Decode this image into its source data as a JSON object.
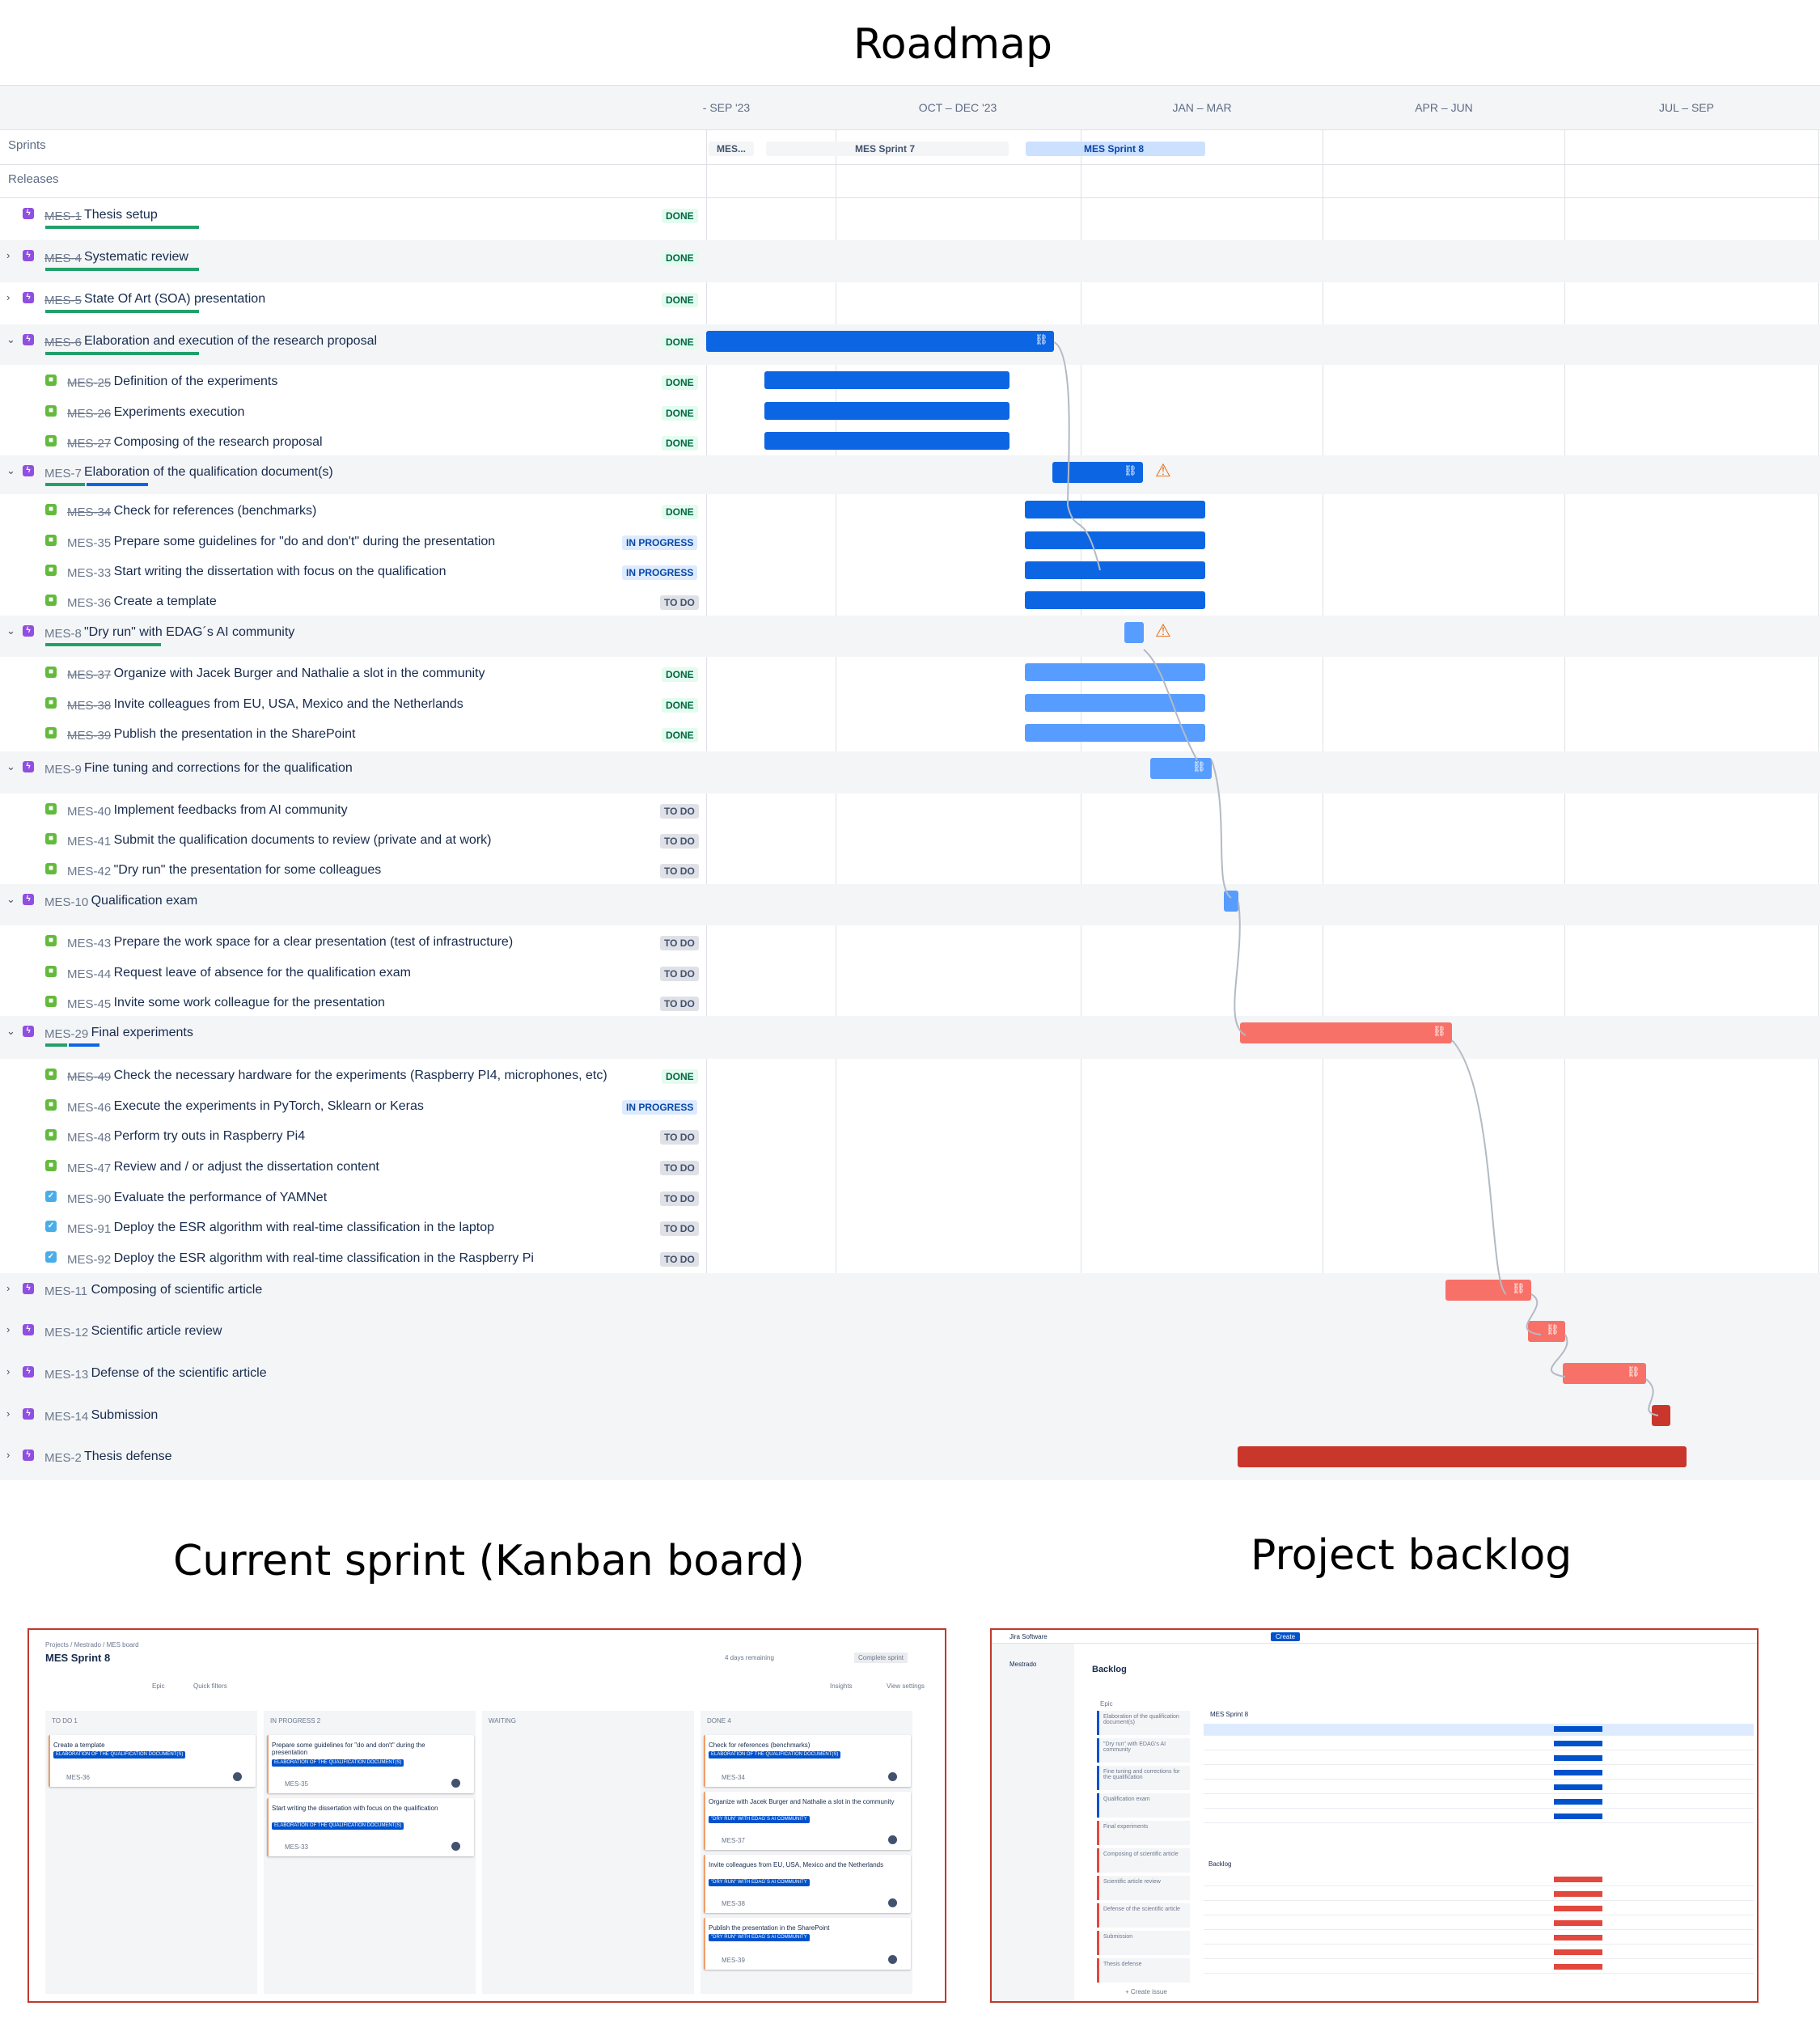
{
  "titles": {
    "roadmap": "Roadmap",
    "kanban": "Current sprint (Kanban board)",
    "backlog": "Project backlog"
  },
  "roadmap": {
    "periods": [
      "- SEP '23",
      "OCT – DEC '23",
      "JAN – MAR",
      "APR – JUN",
      "JUL – SEP"
    ],
    "sprints_label": "Sprints",
    "releases_label": "Releases",
    "sprints": [
      "MES...",
      "MES Sprint 7",
      "MES Sprint 8"
    ],
    "colors": {
      "blue": "#0c66e4",
      "light_blue": "#579dff",
      "salmon": "#f87168",
      "red": "#c9372c"
    },
    "rows": [
      {
        "key": "MES-1",
        "summary": "Thesis setup",
        "status": "DONE",
        "type": "epic",
        "done": true
      },
      {
        "key": "MES-4",
        "summary": "Systematic review",
        "status": "DONE",
        "type": "epic",
        "done": true
      },
      {
        "key": "MES-5",
        "summary": "State Of Art (SOA) presentation",
        "status": "DONE",
        "type": "epic",
        "done": true
      },
      {
        "key": "MES-6",
        "summary": "Elaboration and execution of the research proposal",
        "status": "DONE",
        "type": "epic",
        "done": true
      },
      {
        "key": "MES-25",
        "summary": "Definition of the experiments",
        "status": "DONE",
        "type": "story",
        "done": true
      },
      {
        "key": "MES-26",
        "summary": "Experiments execution",
        "status": "DONE",
        "type": "story",
        "done": true
      },
      {
        "key": "MES-27",
        "summary": "Composing of the research proposal",
        "status": "DONE",
        "type": "story",
        "done": true
      },
      {
        "key": "MES-7",
        "summary": "Elaboration of the qualification document(s)",
        "status": "",
        "type": "epic",
        "done": false
      },
      {
        "key": "MES-34",
        "summary": "Check for references (benchmarks)",
        "status": "DONE",
        "type": "story",
        "done": true
      },
      {
        "key": "MES-35",
        "summary": "Prepare some guidelines for \"do and don't\" during the presentation",
        "status": "IN PROGRESS",
        "type": "story",
        "done": false
      },
      {
        "key": "MES-33",
        "summary": "Start writing the dissertation with focus on the qualification",
        "status": "IN PROGRESS",
        "type": "story",
        "done": false
      },
      {
        "key": "MES-36",
        "summary": "Create a template",
        "status": "TO DO",
        "type": "story",
        "done": false
      },
      {
        "key": "MES-8",
        "summary": "\"Dry run\" with EDAG´s AI community",
        "status": "",
        "type": "epic",
        "done": false
      },
      {
        "key": "MES-37",
        "summary": "Organize with Jacek Burger and Nathalie a slot in the community",
        "status": "DONE",
        "type": "story",
        "done": true
      },
      {
        "key": "MES-38",
        "summary": "Invite colleagues from EU, USA, Mexico and the Netherlands",
        "status": "DONE",
        "type": "story",
        "done": true
      },
      {
        "key": "MES-39",
        "summary": "Publish the presentation in the SharePoint",
        "status": "DONE",
        "type": "story",
        "done": true
      },
      {
        "key": "MES-9",
        "summary": "Fine tuning and corrections for the qualification",
        "status": "",
        "type": "epic",
        "done": false
      },
      {
        "key": "MES-40",
        "summary": "Implement feedbacks from AI community",
        "status": "TO DO",
        "type": "story",
        "done": false
      },
      {
        "key": "MES-41",
        "summary": "Submit the qualification documents to review (private and at work)",
        "status": "TO DO",
        "type": "story",
        "done": false
      },
      {
        "key": "MES-42",
        "summary": "\"Dry run\" the presentation for some colleagues",
        "status": "TO DO",
        "type": "story",
        "done": false
      },
      {
        "key": "MES-10",
        "summary": "Qualification exam",
        "status": "",
        "type": "epic",
        "done": false
      },
      {
        "key": "MES-43",
        "summary": "Prepare the work space for a clear presentation (test of infrastructure)",
        "status": "TO DO",
        "type": "story",
        "done": false
      },
      {
        "key": "MES-44",
        "summary": "Request leave of absence for the qualification exam",
        "status": "TO DO",
        "type": "story",
        "done": false
      },
      {
        "key": "MES-45",
        "summary": "Invite some work colleague for the presentation",
        "status": "TO DO",
        "type": "story",
        "done": false
      },
      {
        "key": "MES-29",
        "summary": "Final experiments",
        "status": "",
        "type": "epic",
        "done": false
      },
      {
        "key": "MES-49",
        "summary": "Check the necessary hardware for the experiments (Raspberry PI4, microphones, etc)",
        "status": "DONE",
        "type": "story",
        "done": true
      },
      {
        "key": "MES-46",
        "summary": "Execute the experiments in PyTorch, Sklearn or Keras",
        "status": "IN PROGRESS",
        "type": "story",
        "done": false
      },
      {
        "key": "MES-48",
        "summary": "Perform try outs in Raspberry Pi4",
        "status": "TO DO",
        "type": "story",
        "done": false
      },
      {
        "key": "MES-47",
        "summary": "Review and / or adjust the dissertation content",
        "status": "TO DO",
        "type": "story",
        "done": false
      },
      {
        "key": "MES-90",
        "summary": "Evaluate the performance of YAMNet",
        "status": "TO DO",
        "type": "task",
        "done": false
      },
      {
        "key": "MES-91",
        "summary": "Deploy the ESR algorithm with real-time classification in the laptop",
        "status": "TO DO",
        "type": "task",
        "done": false
      },
      {
        "key": "MES-92",
        "summary": "Deploy the ESR algorithm with real-time classification in the Raspberry Pi",
        "status": "TO DO",
        "type": "task",
        "done": false
      },
      {
        "key": "MES-11",
        "summary": "Composing of scientific article",
        "status": "",
        "type": "epic",
        "done": false
      },
      {
        "key": "MES-12",
        "summary": "Scientific article review",
        "status": "",
        "type": "epic",
        "done": false
      },
      {
        "key": "MES-13",
        "summary": "Defense of the scientific article",
        "status": "",
        "type": "epic",
        "done": false
      },
      {
        "key": "MES-14",
        "summary": "Submission",
        "status": "",
        "type": "epic",
        "done": false
      },
      {
        "key": "MES-2",
        "summary": "Thesis defense",
        "status": "",
        "type": "epic",
        "done": false
      }
    ]
  },
  "kanban": {
    "breadcrumb": "Projects / Mestrado / MES board",
    "sprint_title": "MES Sprint 8",
    "days_remaining": "4 days remaining",
    "complete_sprint": "Complete sprint",
    "epic_filter": "Epic",
    "quick_filters": "Quick filters",
    "insights": "Insights",
    "view_settings": "View settings",
    "columns": [
      {
        "title": "TO DO 1",
        "cards": [
          {
            "text": "Create a template",
            "tag": "ELABORATION OF THE QUALIFICATION DOCUMENT(S)",
            "key": "MES-36"
          }
        ]
      },
      {
        "title": "IN PROGRESS 2",
        "cards": [
          {
            "text": "Prepare some guidelines for \"do and don't\" during the presentation",
            "tag": "ELABORATION OF THE QUALIFICATION DOCUMENT(S)",
            "key": "MES-35"
          },
          {
            "text": "Start writing the dissertation with focus on the qualification",
            "tag": "ELABORATION OF THE QUALIFICATION DOCUMENT(S)",
            "key": "MES-33"
          }
        ]
      },
      {
        "title": "WAITING",
        "cards": []
      },
      {
        "title": "DONE 4",
        "cards": [
          {
            "text": "Check for references (benchmarks)",
            "tag": "ELABORATION OF THE QUALIFICATION DOCUMENT(S)",
            "key": "MES-34"
          },
          {
            "text": "Organize with Jacek Burger and Nathalie a slot in the community",
            "tag": "\"DRY RUN\" WITH EDAG´S AI COMMUNITY",
            "key": "MES-37"
          },
          {
            "text": "Invite colleagues from EU, USA, Mexico and the Netherlands",
            "tag": "\"DRY RUN\" WITH EDAG´S AI COMMUNITY",
            "key": "MES-38"
          },
          {
            "text": "Publish the presentation in the SharePoint",
            "tag": "\"DRY RUN\" WITH EDAG´S AI COMMUNITY",
            "key": "MES-39"
          }
        ]
      }
    ]
  },
  "backlog": {
    "product": "Jira Software",
    "create": "Create",
    "project": "Mestrado",
    "title": "Backlog",
    "sprint_header": "MES Sprint 8",
    "backlog_header": "Backlog",
    "epic_panel_title": "Epic",
    "create_issue": "+ Create issue",
    "epics": [
      "Elaboration of the qualification document(s)",
      "\"Dry run\" with EDAG's AI community",
      "Fine tuning and corrections for the qualification",
      "Qualification exam",
      "Final experiments",
      "Composing of scientific article",
      "Scientific article review",
      "Defense of the scientific article",
      "Submission",
      "Thesis defense"
    ]
  }
}
